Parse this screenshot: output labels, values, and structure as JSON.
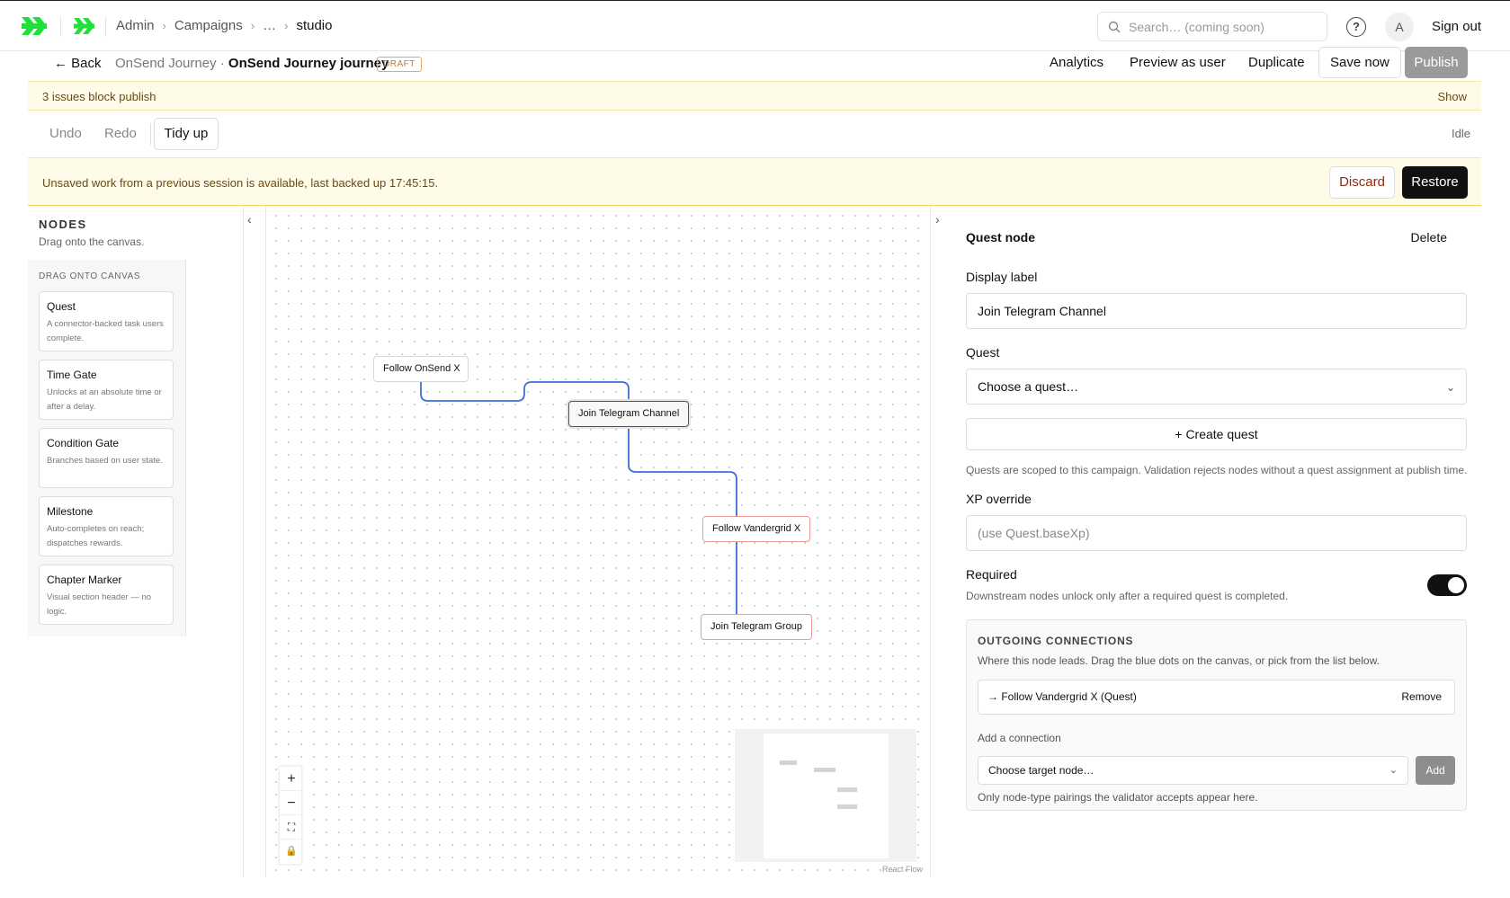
{
  "header": {
    "breadcrumbs": [
      "Admin",
      "Campaigns",
      "…",
      "studio"
    ],
    "search_placeholder": "Search… (coming soon)",
    "help_label": "?",
    "avatar_initial": "A",
    "sign_out": "Sign out",
    "brand_color": "#22e03a"
  },
  "studio": {
    "back": "← Back",
    "campaign": "OnSend Journey ·",
    "journey": "OnSend Journey journey",
    "badge": "DRAFT",
    "actions": {
      "analytics": "Analytics",
      "preview": "Preview as user",
      "duplicate": "Duplicate",
      "save": "Save now",
      "publish": "Publish"
    }
  },
  "issues": {
    "text": "3 issues block publish",
    "show": "Show"
  },
  "toolbar": {
    "undo": "Undo",
    "redo": "Redo",
    "tidy": "Tidy up",
    "status": "Idle"
  },
  "unsaved": {
    "text": "Unsaved work from a previous session is available, last backed up 17:45:15.",
    "discard": "Discard",
    "restore": "Restore"
  },
  "palette": {
    "title": "NODES",
    "subtitle": "Drag onto the canvas.",
    "box_title": "DRAG ONTO CANVAS",
    "items": [
      {
        "title": "Quest",
        "desc": "A connector-backed task users complete."
      },
      {
        "title": "Time Gate",
        "desc": "Unlocks at an absolute time or after a delay."
      },
      {
        "title": "Condition Gate",
        "desc": "Branches based on user state."
      },
      {
        "title": "Milestone",
        "desc": "Auto-completes on reach; dispatches rewards."
      },
      {
        "title": "Chapter Marker",
        "desc": "Visual section header — no logic."
      }
    ]
  },
  "canvas": {
    "nodes": [
      "Follow OnSend X",
      "Join Telegram Channel",
      "Follow Vandergrid X",
      "Join Telegram Group"
    ],
    "edge_color": "#3b6fd6",
    "attribution": "React Flow",
    "controls": [
      "+",
      "−",
      "⛶",
      "🔒"
    ]
  },
  "panel": {
    "title": "Quest node",
    "delete": "Delete",
    "display_label_label": "Display label",
    "display_label_value": "Join Telegram Channel",
    "quest_label": "Quest",
    "quest_value": "Choose a quest…",
    "create_quest": "+ Create quest",
    "quest_help": "Quests are scoped to this campaign. Validation rejects nodes without a quest assignment at publish time.",
    "xp_label": "XP override",
    "xp_placeholder": "(use Quest.baseXp)",
    "required_label": "Required",
    "required_help": "Downstream nodes unlock only after a required quest is completed.",
    "required_on": true,
    "outgoing": {
      "title": "OUTGOING CONNECTIONS",
      "subtitle": "Where this node leads. Drag the blue dots on the canvas, or pick from the list below.",
      "connection": "→ Follow Vandergrid X (Quest)",
      "remove": "Remove",
      "add_label": "Add a connection",
      "target_placeholder": "Choose target node…",
      "add_button": "Add",
      "note": "Only node-type pairings the validator accepts appear here."
    }
  }
}
